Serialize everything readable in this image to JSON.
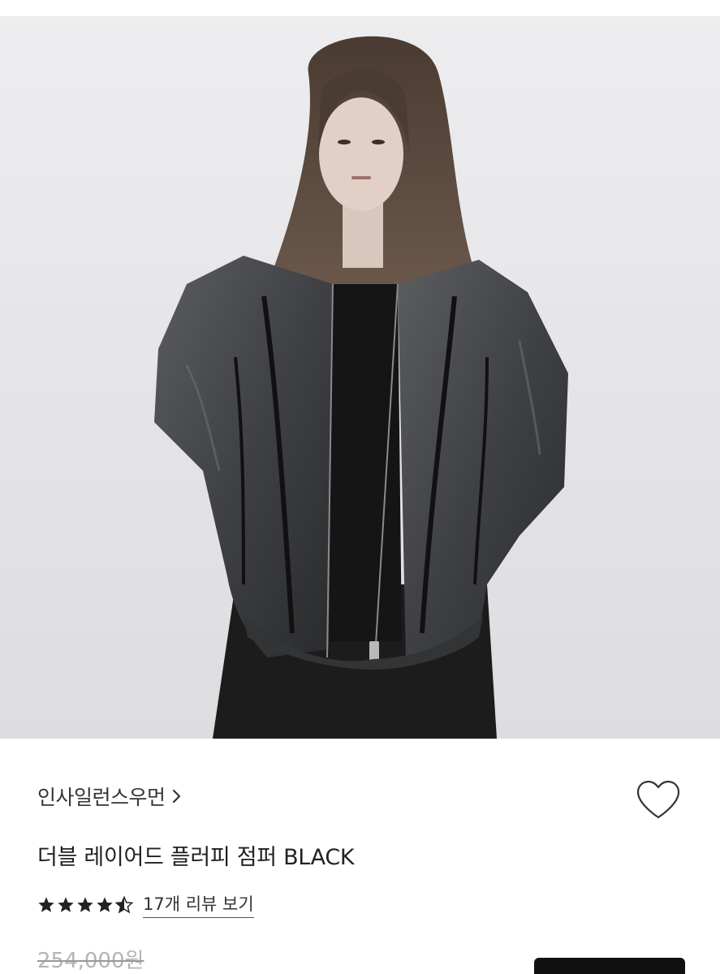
{
  "product": {
    "brand": "인사일런스우먼",
    "name": "더블 레이어드 플러피 점퍼 BLACK",
    "rating": 4.5,
    "review_link": "17개 리뷰 보기",
    "original_price": "254,000원",
    "image_icon": "product-photo",
    "wishlist_icon": "heart-outline-icon",
    "brand_link_icon": "chevron-right-icon"
  },
  "colors": {
    "star": "#222222",
    "text": "#222222",
    "muted": "#b4b4b4",
    "button": "#111111"
  }
}
